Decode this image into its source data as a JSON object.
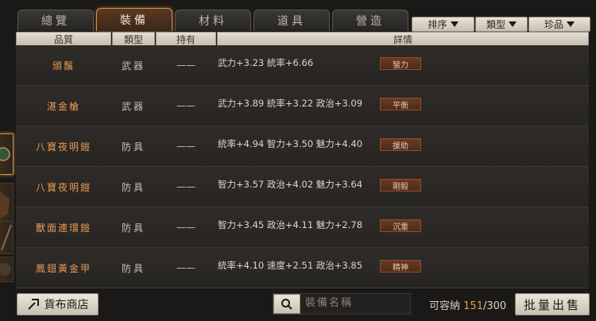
{
  "tabs": [
    "總覽",
    "裝備",
    "材料",
    "道具",
    "營造"
  ],
  "active_tab_index": 1,
  "filters": {
    "sort": "排序",
    "type": "類型",
    "rare": "珍品"
  },
  "columns": {
    "quality": "品質",
    "type": "類型",
    "owner": "持有",
    "detail": "詳情"
  },
  "rows": [
    {
      "name": "頒鬚",
      "type": "武器",
      "owner": "——",
      "detail": "武力+3.23  統率+6.66",
      "skill": "蠻力"
    },
    {
      "name": "湛金槍",
      "type": "武器",
      "owner": "——",
      "detail": "武力+3.89  統率+3.22  政治+3.09",
      "skill": "平衡"
    },
    {
      "name": "八寶夜明鎧",
      "type": "防具",
      "owner": "——",
      "detail": "統率+4.94  智力+3.50  魅力+4.40",
      "skill": "援助"
    },
    {
      "name": "八寶夜明鎧",
      "type": "防具",
      "owner": "——",
      "detail": "智力+3.57  政治+4.02  魅力+3.64",
      "skill": "剛毅"
    },
    {
      "name": "獸面連環鎧",
      "type": "防具",
      "owner": "——",
      "detail": "智力+3.45  政治+4.11  魅力+2.78",
      "skill": "沉重"
    },
    {
      "name": "鳳翅黃金甲",
      "type": "防具",
      "owner": "——",
      "detail": "統率+4.10  速度+2.51  政治+3.85",
      "skill": "精神"
    }
  ],
  "bottom": {
    "shop_label": "貨布商店",
    "search_placeholder": "裝備名稱",
    "capacity_label": "可容納",
    "capacity_current": "151",
    "capacity_max": "/300",
    "sell_label": "批量出售"
  },
  "colors": {
    "accent": "#d9904e",
    "item_name": "#e89a55",
    "capacity_highlight": "#e0a040"
  }
}
